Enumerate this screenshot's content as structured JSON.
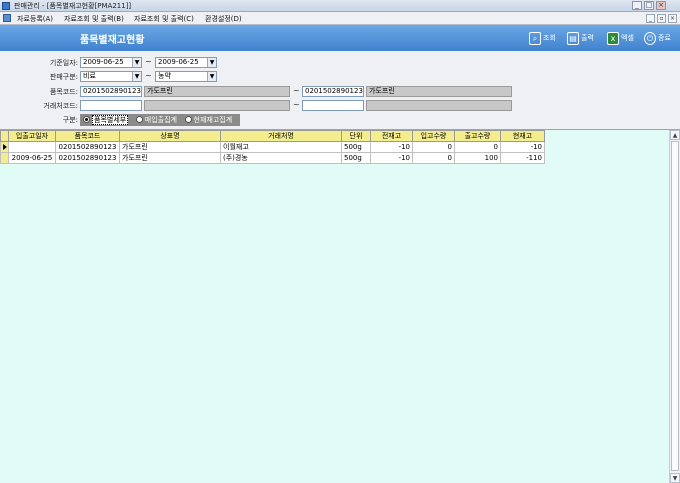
{
  "window": {
    "title": "판매관리 - [품목별재고현황[PMA211]]"
  },
  "menu": {
    "items": [
      "자료등록(A)",
      "자료조회 및 출력(B)",
      "자료조회 및 출력(C)",
      "환경설정(D)"
    ]
  },
  "header": {
    "title": "품목별재고현황",
    "tools": {
      "search": "조회",
      "print": "출력",
      "excel": "엑셀",
      "exit": "종료"
    }
  },
  "form": {
    "date_label": "기준일자:",
    "date_from": "2009-06-25",
    "date_to": "2009-06-25",
    "sales_type_label": "판매구분:",
    "sales_type_from": "비료",
    "sales_type_to": "농약",
    "item_code_label": "품목코드:",
    "item_code_from": "0201502890123",
    "item_name_from": "가도프린",
    "item_code_to": "0201502890123",
    "item_name_to": "가도프린",
    "partner_code_label": "거래처코드:",
    "partner_code_from": "",
    "partner_name_from": "",
    "partner_code_to": "",
    "partner_name_to": "",
    "category_label": "구분:",
    "category_options": [
      "품목별세부",
      "매입출집계",
      "현재재고집계"
    ],
    "category_selected": "품목별세부",
    "tilde": "~"
  },
  "grid": {
    "columns": [
      "입출고일자",
      "품목코드",
      "상표명",
      "거래처명",
      "단위",
      "전재고",
      "입고수량",
      "출고수량",
      "현재고"
    ],
    "rows": [
      [
        "",
        "0201502890123",
        "가도프린",
        "이월재고",
        "500g",
        "-10",
        "0",
        "0",
        "-10"
      ],
      [
        "2009-06-25",
        "0201502890123",
        "가도프린",
        "(주)경농",
        "500g",
        "-10",
        "0",
        "100",
        "-110"
      ]
    ]
  }
}
